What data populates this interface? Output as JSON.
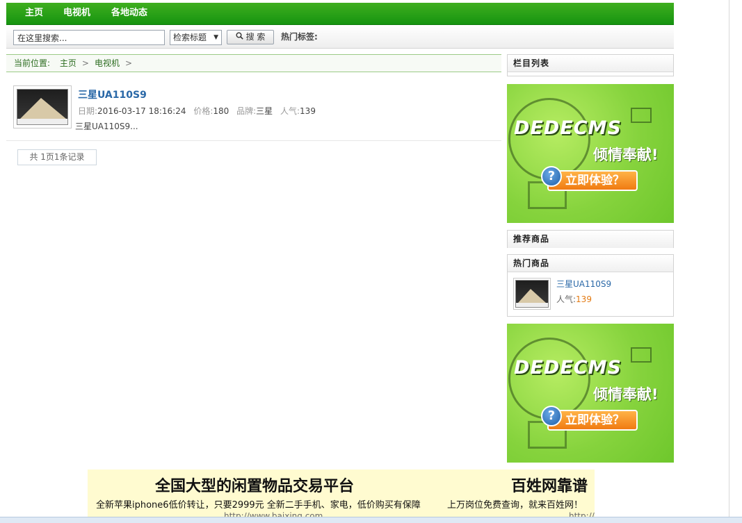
{
  "nav": {
    "items": [
      "主页",
      "电视机",
      "各地动态"
    ]
  },
  "search": {
    "placeholder": "在这里搜索...",
    "select_value": "检索标题",
    "button_label": "搜 索",
    "hot_tags_label": "热门标签:"
  },
  "breadcrumb": {
    "prefix": "当前位置:",
    "items": [
      "主页",
      "电视机"
    ]
  },
  "product": {
    "title": "三星UA110S9",
    "date_label": "日期:",
    "date": "2016-03-17 18:16:24",
    "price_label": "价格:",
    "price": "180",
    "brand_label": "品牌:",
    "brand": "三星",
    "popularity_label": "人气:",
    "popularity": "139",
    "description": "三星UA110S9..."
  },
  "pager": {
    "text": "共 1页1条记录"
  },
  "sidebar": {
    "column_list_title": "栏目列表",
    "recommended_title": "推荐商品",
    "hot_title": "热门商品",
    "hot_item": {
      "title": "三星UA110S9",
      "popularity_label": "人气:",
      "popularity": "139"
    },
    "ad": {
      "logo": "DEDECMS",
      "tagline": "倾情奉献!",
      "cta": "立即体验？",
      "q_mark": "?"
    }
  },
  "bottom_ad": {
    "left_heading": "全国大型的闲置物品交易平台",
    "left_subtext": "全新苹果iphone6低价转让，只要2999元 全新二手手机、家电，低价购买有保障",
    "left_url": "http://www.baixing.com",
    "right_heading": "百姓网靠谱",
    "right_subtext": "上万岗位免费查询，就来百姓网！",
    "right_url": "http://v"
  },
  "colors": {
    "nav_green": "#169410",
    "link_blue": "#2a68a7",
    "accent_orange": "#e37a12",
    "ad_green": "#86d33d"
  }
}
